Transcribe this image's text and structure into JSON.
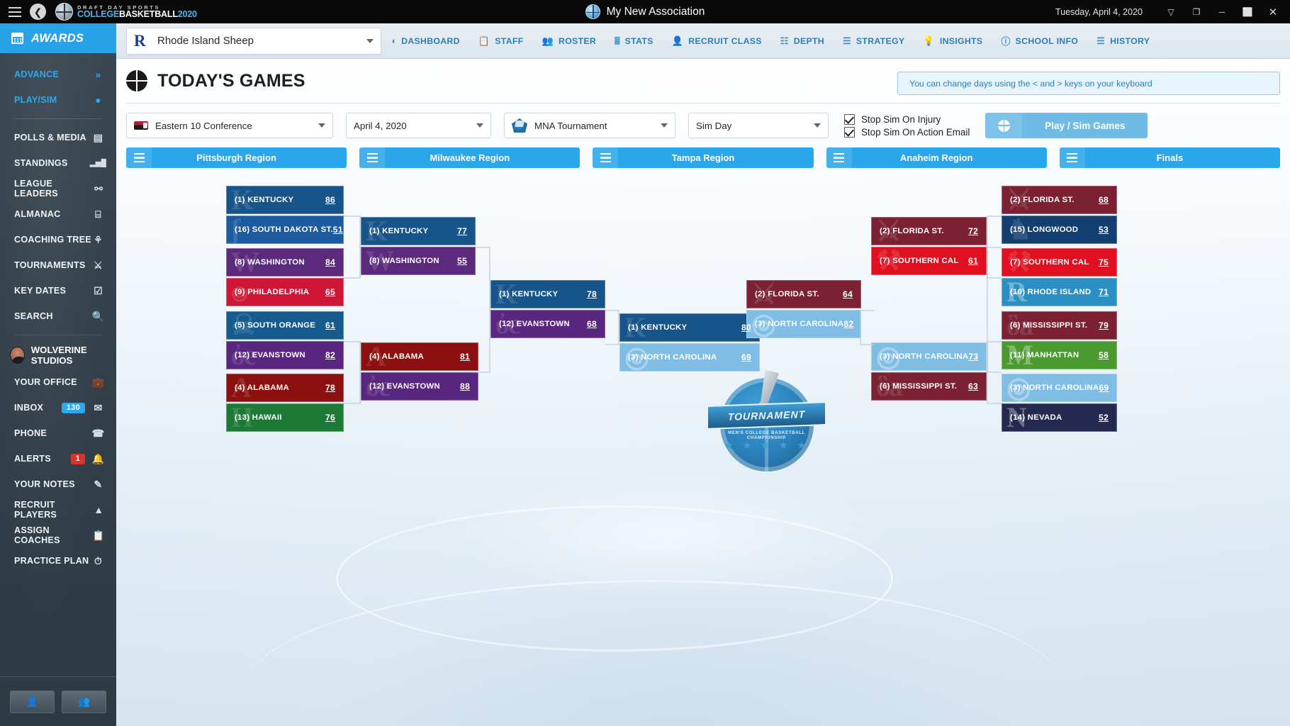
{
  "titlebar": {
    "menu_icon": "hamburger-icon",
    "back_icon": "back-arrow-icon",
    "logo_line1": "DRAFT DAY SPORTS",
    "logo_line2a": "COLLEGE",
    "logo_line2b": "BASKETBALL",
    "logo_line2c": "2020",
    "association_title": "My New Association",
    "date": "Tuesday, April 4, 2020",
    "dropdown_icon": "▽",
    "minimize_icon": "─",
    "maximize_icon": "❐",
    "restore_icon": "⬜",
    "close_icon": "✕"
  },
  "sidebar": {
    "awards_label": "AWARDS",
    "top_items": [
      {
        "label": "ADVANCE",
        "icon": "double-chevron-right-icon",
        "glyph": "»"
      },
      {
        "label": "PLAY/SIM",
        "icon": "basketball-icon",
        "glyph": "●"
      }
    ],
    "items": [
      {
        "label": "POLLS & MEDIA",
        "icon": "newspaper-icon",
        "glyph": "▤"
      },
      {
        "label": "STANDINGS",
        "icon": "bar-chart-icon",
        "glyph": "▂▅█"
      },
      {
        "label": "LEAGUE LEADERS",
        "icon": "people-icon",
        "glyph": "⚯"
      },
      {
        "label": "ALMANAC",
        "icon": "archive-box-icon",
        "glyph": "⌸"
      },
      {
        "label": "COACHING TREE",
        "icon": "tree-icon",
        "glyph": "⚘"
      },
      {
        "label": "TOURNAMENTS",
        "icon": "trophy-icon",
        "glyph": "Ἴ6"
      },
      {
        "label": "KEY DATES",
        "icon": "calendar-check-icon",
        "glyph": "☑"
      },
      {
        "label": "SEARCH",
        "icon": "magnifier-icon",
        "glyph": "⚲"
      }
    ],
    "studio_name": "WOLVERINE STUDIOS",
    "user_items": [
      {
        "label": "YOUR OFFICE",
        "icon": "briefcase-icon",
        "glyph": "⚒",
        "badge": ""
      },
      {
        "label": "INBOX",
        "icon": "envelope-icon",
        "glyph": "✉",
        "badge": "130",
        "badge_color": "blue"
      },
      {
        "label": "PHONE",
        "icon": "phone-icon",
        "glyph": "☎",
        "badge": ""
      },
      {
        "label": "ALERTS",
        "icon": "bell-icon",
        "glyph": "ὑ4",
        "badge": "1",
        "badge_color": "red"
      },
      {
        "label": "YOUR NOTES",
        "icon": "edit-note-icon",
        "glyph": "✎",
        "badge": ""
      },
      {
        "label": "RECRUIT PLAYERS",
        "icon": "megaphone-icon",
        "glyph": "▲",
        "badge": ""
      },
      {
        "label": "ASSIGN COACHES",
        "icon": "clipboard-icon",
        "glyph": "Ὄb",
        "badge": ""
      },
      {
        "label": "PRACTICE PLAN",
        "icon": "stopwatch-icon",
        "glyph": "⏱",
        "badge": ""
      }
    ],
    "bottom_buttons": [
      {
        "icon": "user-icon",
        "glyph": "♟"
      },
      {
        "icon": "users-add-icon",
        "glyph": "♟⚙"
      }
    ]
  },
  "topnav": {
    "team_name": "Rhode Island Sheep",
    "team_logo": "rhode-island-ri-logo",
    "tabs": [
      {
        "label": "DASHBOARD",
        "icon": "gauge-icon",
        "glyph": "◔"
      },
      {
        "label": "STAFF",
        "icon": "clipboard-icon",
        "glyph": "Ὄb"
      },
      {
        "label": "ROSTER",
        "icon": "people-icon",
        "glyph": "⚯"
      },
      {
        "label": "STATS",
        "icon": "bar-chart-icon",
        "glyph": "▃▆█"
      },
      {
        "label": "RECRUIT CLASS",
        "icon": "recruit-icon",
        "glyph": "⚹"
      },
      {
        "label": "DEPTH",
        "icon": "org-chart-icon",
        "glyph": "☷"
      },
      {
        "label": "STRATEGY",
        "icon": "sliders-icon",
        "glyph": "☲"
      },
      {
        "label": "INSIGHTS",
        "icon": "lightbulb-icon",
        "glyph": "Ὂ1"
      },
      {
        "label": "SCHOOL INFO",
        "icon": "info-circle-icon",
        "glyph": "ℹ"
      },
      {
        "label": "HISTORY",
        "icon": "book-icon",
        "glyph": "☰"
      }
    ]
  },
  "page": {
    "title": "TODAY'S GAMES",
    "title_icon": "basketball-icon",
    "hint": "You can change days using the < and > keys on your keyboard"
  },
  "controls": {
    "conference": "Eastern 10 Conference",
    "conference_icon": "eastern-10-logo",
    "date": "April 4, 2020",
    "tournament": "MNA Tournament",
    "tournament_icon": "mna-tournament-logo",
    "sim_mode": "Sim Day",
    "checkboxes": [
      {
        "label": "Stop Sim On Injury",
        "checked": true
      },
      {
        "label": "Stop Sim On Action Email",
        "checked": true
      }
    ],
    "play_sim_label": "Play / Sim Games",
    "play_sim_icon": "basketball-icon"
  },
  "bracket": {
    "regions": [
      {
        "label": "Pittsburgh Region",
        "icon": "menu-lines-icon"
      },
      {
        "label": "Milwaukee Region",
        "icon": "menu-lines-icon"
      },
      {
        "label": "Tampa Region",
        "icon": "menu-lines-icon"
      },
      {
        "label": "Anaheim Region",
        "icon": "menu-lines-icon"
      },
      {
        "label": "Finals",
        "icon": "menu-lines-icon"
      }
    ],
    "center_logo": {
      "banner": "TOURNAMENT",
      "sub": "MEN'S COLLEGE BASKETBALL CHAMPIONSHIP",
      "stars": "★ ★ ★ ★ ★"
    },
    "matchups": [
      {
        "id": "p-r1-1",
        "col": 1,
        "teams": [
          {
            "seed": "(1)",
            "name": "KENTUCKY",
            "score": "86",
            "color": "#17548a",
            "ghost": "K",
            "light": false
          },
          {
            "seed": "(16)",
            "name": "SOUTH DAKOTA ST.",
            "score": "51",
            "color": "#1d5ba0",
            "ghost": "ʃ",
            "light": false
          }
        ]
      },
      {
        "id": "p-r1-2",
        "col": 1,
        "teams": [
          {
            "seed": "(8)",
            "name": "WASHINGTON",
            "score": "84",
            "color": "#5b2a7d",
            "ghost": "W",
            "light": false
          },
          {
            "seed": "(9)",
            "name": "PHILADELPHIA",
            "score": "65",
            "color": "#cf1637",
            "ghost": "๏",
            "light": false
          }
        ]
      },
      {
        "id": "p-r1-3",
        "col": 1,
        "teams": [
          {
            "seed": "(5)",
            "name": "SOUTH ORANGE",
            "score": "61",
            "color": "#155b8e",
            "ghost": "☠",
            "light": false
          },
          {
            "seed": "(12)",
            "name": "EVANSTOWN",
            "score": "82",
            "color": "#5a2780",
            "ghost": "ὀe",
            "light": false
          }
        ]
      },
      {
        "id": "p-r1-4",
        "col": 1,
        "teams": [
          {
            "seed": "(4)",
            "name": "ALABAMA",
            "score": "78",
            "color": "#8c1010",
            "ghost": "A",
            "light": false
          },
          {
            "seed": "(13)",
            "name": "HAWAII",
            "score": "76",
            "color": "#1c7a36",
            "ghost": "H",
            "light": false
          }
        ]
      },
      {
        "id": "p-r2-1",
        "col": 2,
        "teams": [
          {
            "seed": "(1)",
            "name": "KENTUCKY",
            "score": "77",
            "color": "#17548a",
            "ghost": "K",
            "light": false
          },
          {
            "seed": "(8)",
            "name": "WASHINGTON",
            "score": "55",
            "color": "#5b2a7d",
            "ghost": "W",
            "light": false
          }
        ]
      },
      {
        "id": "p-r2-2",
        "col": 2,
        "teams": [
          {
            "seed": "(4)",
            "name": "ALABAMA",
            "score": "81",
            "color": "#8c1010",
            "ghost": "A",
            "light": false
          },
          {
            "seed": "(12)",
            "name": "EVANSTOWN",
            "score": "88",
            "color": "#5a2780",
            "ghost": "ὀe",
            "light": false
          }
        ]
      },
      {
        "id": "p-r3-1",
        "col": 3,
        "teams": [
          {
            "seed": "(1)",
            "name": "KENTUCKY",
            "score": "78",
            "color": "#17548a",
            "ghost": "K",
            "light": false
          },
          {
            "seed": "(12)",
            "name": "EVANSTOWN",
            "score": "68",
            "color": "#5a2780",
            "ghost": "ὀe",
            "light": false
          }
        ]
      },
      {
        "id": "final",
        "col": 4,
        "teams": [
          {
            "seed": "(1)",
            "name": "KENTUCKY",
            "score": "80",
            "color": "#17548a",
            "ghost": "K",
            "light": false
          },
          {
            "seed": "(3)",
            "name": "NORTH CAROLINA",
            "score": "69",
            "color": "#7fbde4",
            "ghost": "◎",
            "light": true
          }
        ]
      },
      {
        "id": "t-r3-1",
        "col": 5,
        "teams": [
          {
            "seed": "(2)",
            "name": "FLORIDA ST.",
            "score": "64",
            "color": "#7b2133",
            "ghost": "⚔",
            "light": false
          },
          {
            "seed": "(3)",
            "name": "NORTH CAROLINA",
            "score": "82",
            "color": "#7fbde4",
            "ghost": "◎",
            "light": true
          }
        ]
      },
      {
        "id": "a-r2-1",
        "col": 6,
        "teams": [
          {
            "seed": "(2)",
            "name": "FLORIDA ST.",
            "score": "72",
            "color": "#7b2133",
            "ghost": "⚔",
            "light": false
          },
          {
            "seed": "(7)",
            "name": "SOUTHERN CAL",
            "score": "61",
            "color": "#e01020",
            "ghost": "⚒",
            "light": false
          }
        ]
      },
      {
        "id": "a-r2-2",
        "col": 6,
        "teams": [
          {
            "seed": "(3)",
            "name": "NORTH CAROLINA",
            "score": "73",
            "color": "#7fbde4",
            "ghost": "◎",
            "light": true
          },
          {
            "seed": "(6)",
            "name": "MISSISSIPPI ST.",
            "score": "63",
            "color": "#7b2133",
            "ghost": "ὃa",
            "light": false
          }
        ]
      },
      {
        "id": "a-r1-1",
        "col": 7,
        "teams": [
          {
            "seed": "(2)",
            "name": "FLORIDA ST.",
            "score": "68",
            "color": "#7b2133",
            "ghost": "⚔",
            "light": false
          },
          {
            "seed": "(15)",
            "name": "LONGWOOD",
            "score": "53",
            "color": "#123f70",
            "ghost": "♞",
            "light": false
          }
        ]
      },
      {
        "id": "a-r1-2",
        "col": 7,
        "teams": [
          {
            "seed": "(7)",
            "name": "SOUTHERN CAL",
            "score": "75",
            "color": "#e01020",
            "ghost": "⚒",
            "light": false
          },
          {
            "seed": "(10)",
            "name": "RHODE ISLAND",
            "score": "71",
            "color": "#2b8fc4",
            "ghost": "R",
            "light": true
          }
        ]
      },
      {
        "id": "a-r1-3",
        "col": 7,
        "teams": [
          {
            "seed": "(6)",
            "name": "MISSISSIPPI ST.",
            "score": "79",
            "color": "#7b2133",
            "ghost": "ὃa",
            "light": false
          },
          {
            "seed": "(11)",
            "name": "MANHATTAN",
            "score": "58",
            "color": "#4a9a2f",
            "ghost": "M",
            "light": true
          }
        ]
      },
      {
        "id": "a-r1-4",
        "col": 7,
        "teams": [
          {
            "seed": "(3)",
            "name": "NORTH CAROLINA",
            "score": "69",
            "color": "#7fbde4",
            "ghost": "◎",
            "light": true
          },
          {
            "seed": "(14)",
            "name": "NEVADA",
            "score": "52",
            "color": "#25284f",
            "ghost": "N",
            "light": true
          }
        ]
      }
    ]
  }
}
